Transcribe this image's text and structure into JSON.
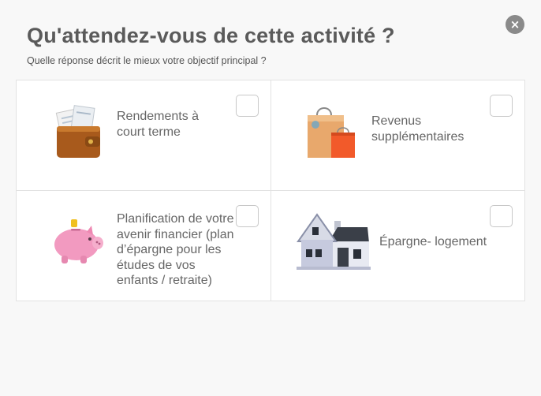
{
  "dialog": {
    "title": "Qu'attendez-vous de cette activité ?",
    "subtitle": "Quelle réponse décrit le mieux votre objectif principal ?",
    "close_label": "×"
  },
  "options": [
    {
      "label": "Rendements à court terme",
      "icon": "wallet-icon",
      "checked": false
    },
    {
      "label": "Revenus supplémentaires",
      "icon": "shopping-bags-icon",
      "checked": false
    },
    {
      "label": "Planification de votre avenir financier (plan d’épargne pour les études de vos enfants / retraite)",
      "icon": "piggy-bank-icon",
      "checked": false
    },
    {
      "label": "Épargne- logement",
      "icon": "house-icon",
      "checked": false
    }
  ]
}
